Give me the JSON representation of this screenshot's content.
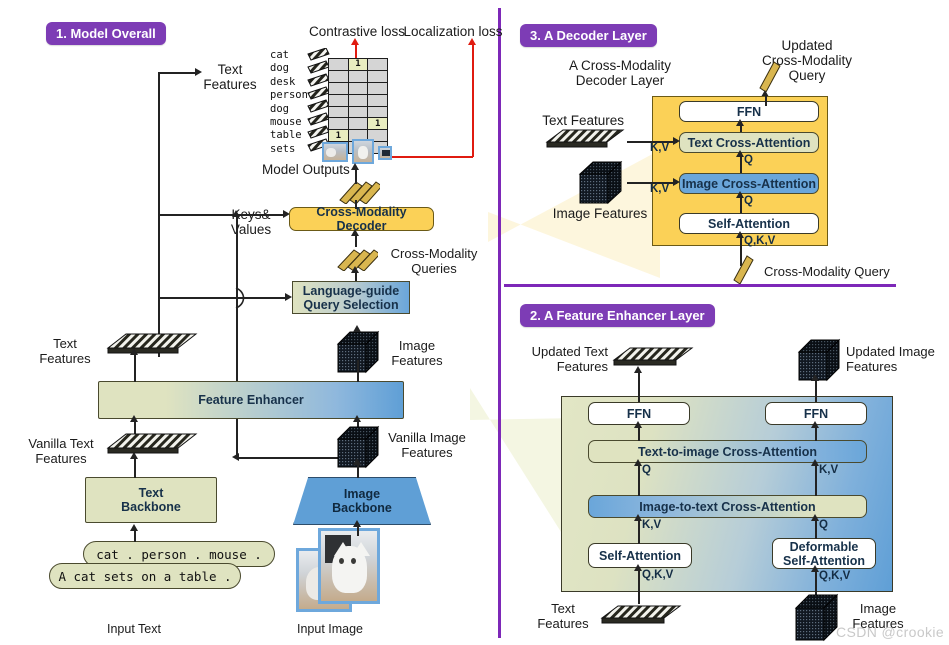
{
  "figure": {
    "watermark": "CSDN @crookie"
  },
  "panels": [
    {
      "id": "overall",
      "badge": "1. Model Overall"
    },
    {
      "id": "enhancer",
      "badge": "2. A Feature Enhancer Layer"
    },
    {
      "id": "decoder",
      "badge": "3. A Decoder Layer"
    }
  ],
  "colors": {
    "accent_purple": "#7D3CB5",
    "divider_purple": "#7D28B8",
    "olive": "#dfe3c0",
    "blue": "#6aa6da",
    "yellow": "#fbd157",
    "loss_red": "#e01b10"
  },
  "overall": {
    "losses": {
      "contrastive": "Contrastive loss",
      "localization": "Localization loss"
    },
    "matrix": {
      "rows": [
        "cat",
        "dog",
        "desk",
        "person",
        "dog",
        "mouse",
        "table",
        "sets"
      ],
      "columns": 3,
      "cells": [
        [
          0,
          1,
          0
        ],
        [
          0,
          0,
          0
        ],
        [
          0,
          0,
          0
        ],
        [
          0,
          0,
          0
        ],
        [
          0,
          0,
          0
        ],
        [
          0,
          0,
          1
        ],
        [
          1,
          0,
          0
        ],
        [
          0,
          0,
          0
        ]
      ],
      "hit_value": "1"
    },
    "model_outputs_label": "Model Outputs",
    "text_features_top_label": "Text\nFeatures",
    "keys_values_label": "Keys&\nValues",
    "decoder_box": "Cross-Modality Decoder",
    "cross_modality_queries_label": "Cross-Modality\nQueries",
    "query_selection_box": "Language-guide\nQuery Selection",
    "image_features_label": "Image\nFeatures",
    "text_features_label": "Text\nFeatures",
    "feature_enhancer_box": "Feature Enhancer",
    "vanilla_text_label": "Vanilla Text\nFeatures",
    "vanilla_image_label": "Vanilla Image\nFeatures",
    "text_backbone_box": "Text\nBackbone",
    "image_backbone_box": "Image\nBackbone",
    "prompt_line_1": "cat . person . mouse .",
    "prompt_line_2": "A cat sets on a table .",
    "input_text_caption": "Input Text",
    "input_image_caption": "Input Image"
  },
  "decoder_layer": {
    "subtitle": "A Cross-Modality\nDecoder Layer",
    "text_features_label": "Text Features",
    "image_features_label": "Image Features",
    "updated_query_label": "Updated\nCross-Modality\nQuery",
    "input_query_label": "Cross-Modality Query",
    "blocks": [
      {
        "label": "FFN",
        "style": "white"
      },
      {
        "label": "Text Cross-Attention",
        "style": "olive"
      },
      {
        "label": "Image Cross-Attention",
        "style": "blue"
      },
      {
        "label": "Self-Attention",
        "style": "white"
      }
    ],
    "edge_labels": {
      "text_kv": "K,V",
      "image_kv": "K,V",
      "q_text": "Q",
      "q_image": "Q",
      "qkv_self": "Q,K,V"
    }
  },
  "enhancer_layer": {
    "updated_text_label": "Updated Text\nFeatures",
    "updated_image_label": "Updated Image\nFeatures",
    "text_features_label": "Text\nFeatures",
    "image_features_label": "Image\nFeatures",
    "blocks": {
      "ffn_left": "FFN",
      "ffn_right": "FFN",
      "text_to_image": "Text-to-image Cross-Attention",
      "image_to_text": "Image-to-text Cross-Attention",
      "self_attention": "Self-Attention",
      "deformable_self_attention": "Deformable\nSelf-Attention"
    },
    "edge_labels": {
      "q_left_top": "Q",
      "kv_right_top": "K,V",
      "kv_left_bottom": "K,V",
      "q_right_bottom": "Q",
      "qkv_left": "Q,K,V",
      "qkv_right": "Q,K,V"
    }
  }
}
